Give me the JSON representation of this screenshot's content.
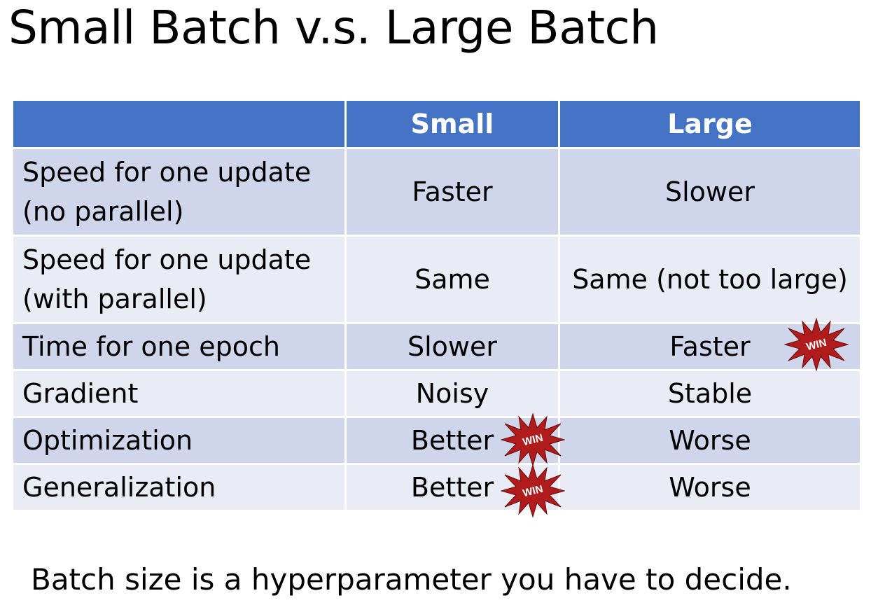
{
  "title": "Small Batch v.s. Large Batch",
  "table": {
    "header": {
      "empty": "",
      "small": "Small",
      "large": "Large"
    },
    "rows": [
      {
        "label_line1": "Speed for one update",
        "label_line2": "(no parallel)",
        "small": "Faster",
        "large": "Slower",
        "winner": "none"
      },
      {
        "label_line1": "Speed for one update",
        "label_line2": "(with parallel)",
        "small": "Same",
        "large": "Same (not too large)",
        "winner": "none"
      },
      {
        "label_line1": "Time for one epoch",
        "label_line2": "",
        "small": "Slower",
        "large": "Faster",
        "winner": "large"
      },
      {
        "label_line1": "Gradient",
        "label_line2": "",
        "small": "Noisy",
        "large": "Stable",
        "winner": "none"
      },
      {
        "label_line1": "Optimization",
        "label_line2": "",
        "small": "Better",
        "large": "Worse",
        "winner": "small"
      },
      {
        "label_line1": "Generalization",
        "label_line2": "",
        "small": "Better",
        "large": "Worse",
        "winner": "small"
      }
    ]
  },
  "badge": {
    "text": "WIN",
    "fill_color": "#b01c1c",
    "icon": "win-starburst-icon"
  },
  "colors": {
    "header_bg": "#4472c4",
    "row_odd_bg": "#cfd5ea",
    "row_even_bg": "#e9ebf5"
  },
  "footer": "Batch size is a hyperparameter you have to decide."
}
